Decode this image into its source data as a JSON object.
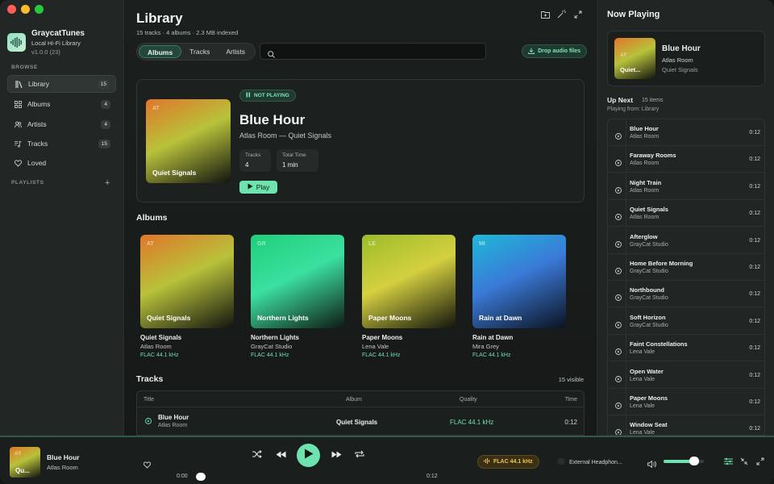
{
  "sidebar": {
    "app_name": "GraycatTunes",
    "app_subtitle": "Local Hi-Fi Library",
    "app_version": "v1.0.0 (23)",
    "browse_label": "BROWSE",
    "playlists_label": "PLAYLISTS",
    "items": [
      {
        "label": "Library",
        "count": "15",
        "icon": "library-icon"
      },
      {
        "label": "Albums",
        "count": "4",
        "icon": "grid-icon"
      },
      {
        "label": "Artists",
        "count": "4",
        "icon": "people-icon"
      },
      {
        "label": "Tracks",
        "count": "15",
        "icon": "music-list-icon"
      },
      {
        "label": "Loved",
        "count": "",
        "icon": "heart-icon"
      }
    ]
  },
  "header": {
    "title": "Library",
    "subtitle": "15 tracks · 4 albums · 2.3 MB indexed",
    "tabs": [
      {
        "label": "Albums"
      },
      {
        "label": "Tracks"
      },
      {
        "label": "Artists"
      }
    ],
    "drop_label": "Drop audio files"
  },
  "hero": {
    "status": "NOT PLAYING",
    "title": "Blue Hour",
    "subtitle": "Atlas Room — Quiet Signals",
    "art_abbr": "AT",
    "art_name": "Quiet Signals",
    "tracks_label": "Tracks",
    "tracks_value": "4",
    "time_label": "Total Time",
    "time_value": "1 min",
    "play_label": "Play"
  },
  "albums_heading": "Albums",
  "albums": [
    {
      "abbr": "AT",
      "name": "Quiet Signals",
      "artist": "Atlas Room",
      "quality": "FLAC 44.1 kHz",
      "colors": [
        "#e0762a",
        "#b8c23a",
        "#12140f"
      ]
    },
    {
      "abbr": "GR",
      "name": "Northern Lights",
      "artist": "GrayCat Studio",
      "quality": "FLAC 44.1 kHz",
      "colors": [
        "#1fcf7a",
        "#3be0a0",
        "#0e1a14"
      ]
    },
    {
      "abbr": "LE",
      "name": "Paper Moons",
      "artist": "Lena Vale",
      "quality": "FLAC 44.1 kHz",
      "colors": [
        "#9cbc2a",
        "#d4d040",
        "#12140c"
      ]
    },
    {
      "abbr": "MI",
      "name": "Rain at Dawn",
      "artist": "Mira Grey",
      "quality": "FLAC 44.1 kHz",
      "colors": [
        "#1fb8d8",
        "#3a7ad8",
        "#0c1220"
      ]
    }
  ],
  "tracks_heading": "Tracks",
  "tracks_visible": "15 visible",
  "track_table": {
    "columns": [
      "Title",
      "Album",
      "Quality",
      "Time"
    ],
    "rows": [
      {
        "title": "Blue Hour",
        "artist": "Atlas Room",
        "album": "Quiet Signals",
        "quality": "FLAC 44.1 kHz",
        "time": "0:12"
      }
    ]
  },
  "now_playing": {
    "heading": "Now Playing",
    "title": "Blue Hour",
    "artist": "Atlas Room",
    "album": "Quiet Signals",
    "art_abbr": "AT",
    "art_name": "Quiet..."
  },
  "up_next": {
    "label": "Up Next",
    "count": "15 items",
    "playing_from": "Playing from: Library",
    "items": [
      {
        "title": "Blue Hour",
        "artist": "Atlas Room",
        "time": "0:12"
      },
      {
        "title": "Faraway Rooms",
        "artist": "Atlas Room",
        "time": "0:12"
      },
      {
        "title": "Night Train",
        "artist": "Atlas Room",
        "time": "0:12"
      },
      {
        "title": "Quiet Signals",
        "artist": "Atlas Room",
        "time": "0:12"
      },
      {
        "title": "Afterglow",
        "artist": "GrayCat Studio",
        "time": "0:12"
      },
      {
        "title": "Home Before Morning",
        "artist": "GrayCat Studio",
        "time": "0:12"
      },
      {
        "title": "Northbound",
        "artist": "GrayCat Studio",
        "time": "0:12"
      },
      {
        "title": "Soft Horizon",
        "artist": "GrayCat Studio",
        "time": "0:12"
      },
      {
        "title": "Faint Constellations",
        "artist": "Lena Vale",
        "time": "0:12"
      },
      {
        "title": "Open Water",
        "artist": "Lena Vale",
        "time": "0:12"
      },
      {
        "title": "Paper Moons",
        "artist": "Lena Vale",
        "time": "0:12"
      },
      {
        "title": "Window Seat",
        "artist": "Lena Vale",
        "time": "0:12"
      }
    ]
  },
  "player": {
    "title": "Blue Hour",
    "artist": "Atlas Room",
    "art_abbr": "AT",
    "art_name": "Qu...",
    "elapsed": "0:00",
    "duration": "0:12",
    "progress": 0.0,
    "format": "FLAC 44.1 kHz",
    "device": "External Headphon...",
    "volume": 0.85
  },
  "colors": {
    "accent": "#6ee3b0",
    "format_badge": "#f2c24a"
  }
}
